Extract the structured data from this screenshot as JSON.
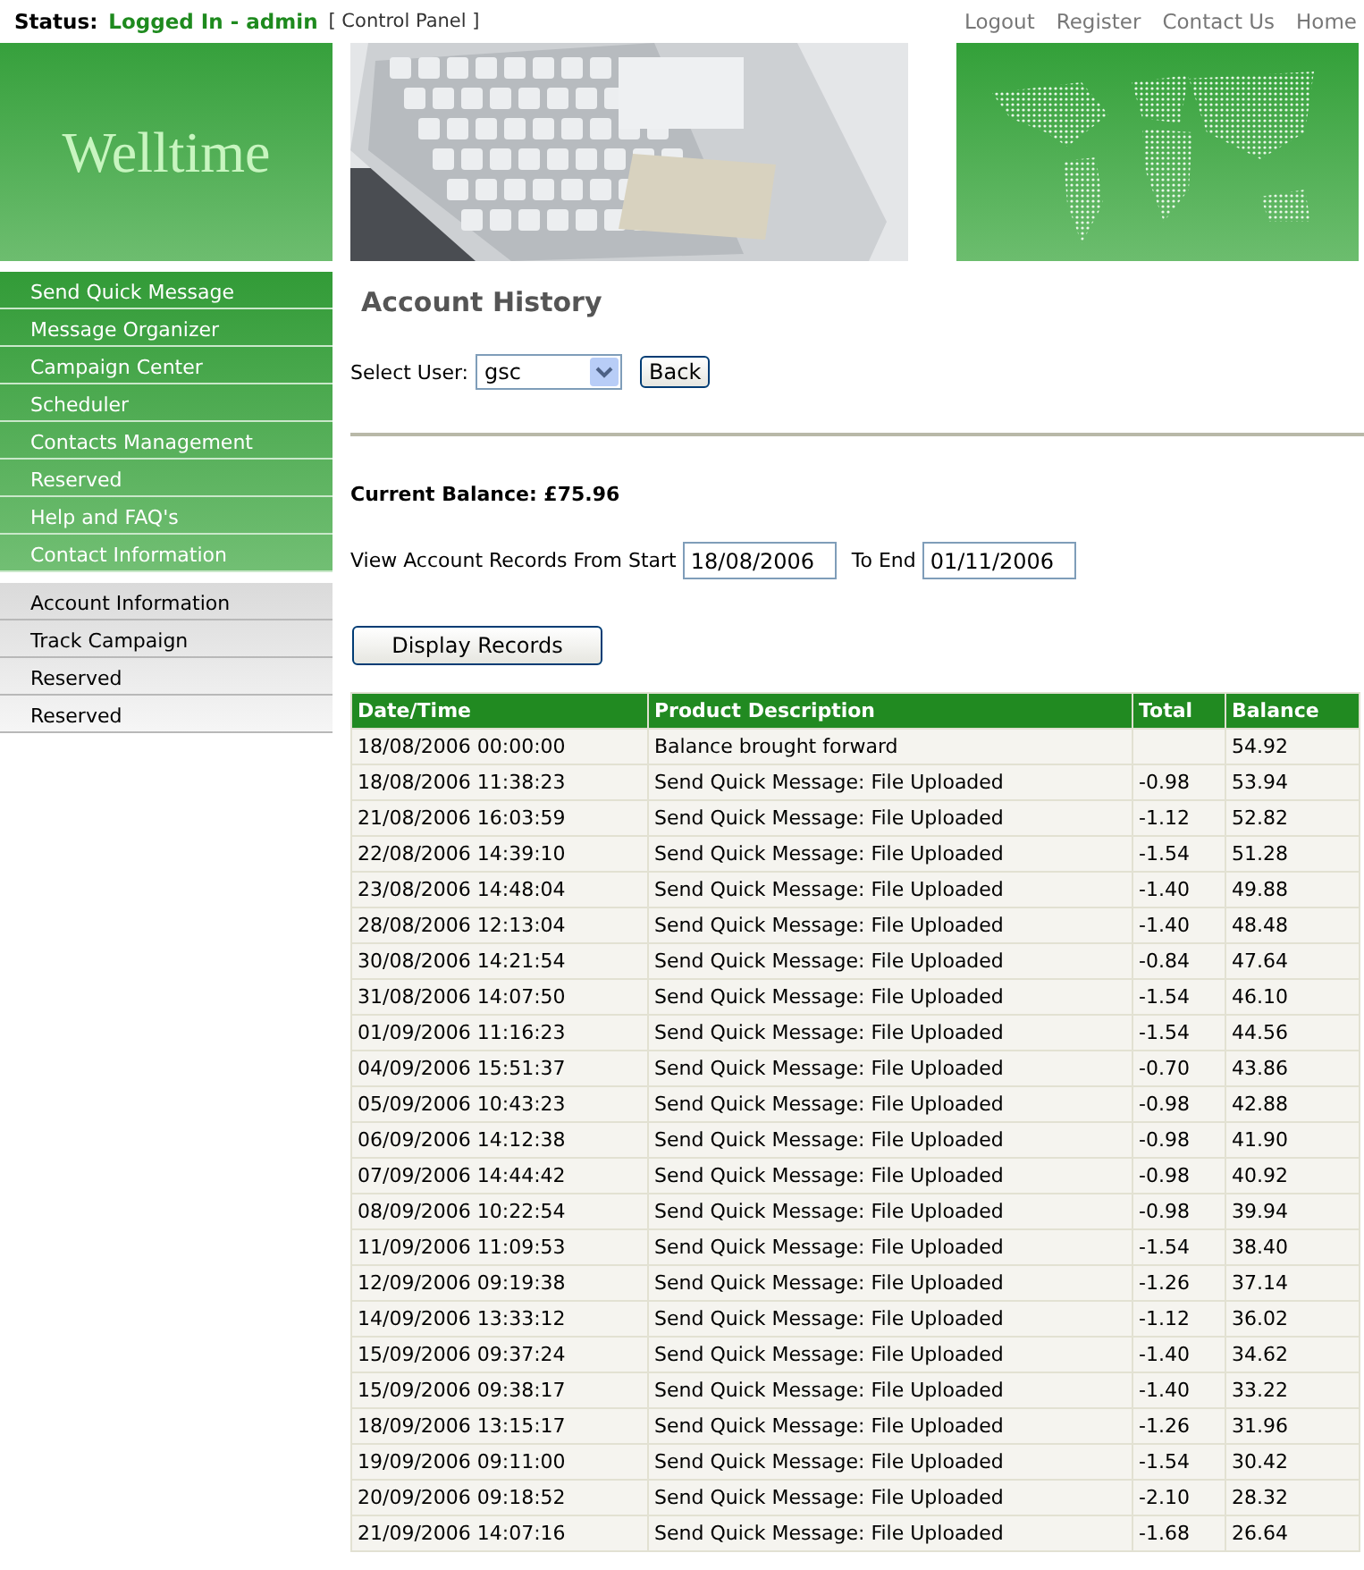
{
  "status": {
    "label": "Status:",
    "value": "Logged In - admin",
    "link": "[ Control Panel ]"
  },
  "top_links": [
    "Logout",
    "Register",
    "Contact Us",
    "Home"
  ],
  "logo": "Welltime",
  "main_menu": [
    "Send Quick Message",
    "Message Organizer",
    "Campaign Center",
    "Scheduler",
    "Contacts Management",
    "Reserved",
    "Help and FAQ's",
    "Contact Information"
  ],
  "account_menu": [
    "Account Information",
    "Track Campaign",
    "Reserved",
    "Reserved"
  ],
  "page_title": "Account History",
  "select_user": {
    "label": "Select User:",
    "value": "gsc"
  },
  "back_button": "Back",
  "current_balance": "Current Balance: £75.96",
  "records_range": {
    "label": "View Account Records From Start",
    "start": "18/08/2006",
    "to_label": "To End",
    "end": "01/11/2006"
  },
  "display_button": "Display Records",
  "table": {
    "columns": [
      "Date/Time",
      "Product Description",
      "Total",
      "Balance"
    ],
    "rows": [
      [
        "18/08/2006 00:00:00",
        "Balance brought forward",
        "",
        "54.92"
      ],
      [
        "18/08/2006 11:38:23",
        "Send Quick Message: File Uploaded",
        "-0.98",
        "53.94"
      ],
      [
        "21/08/2006 16:03:59",
        "Send Quick Message: File Uploaded",
        "-1.12",
        "52.82"
      ],
      [
        "22/08/2006 14:39:10",
        "Send Quick Message: File Uploaded",
        "-1.54",
        "51.28"
      ],
      [
        "23/08/2006 14:48:04",
        "Send Quick Message: File Uploaded",
        "-1.40",
        "49.88"
      ],
      [
        "28/08/2006 12:13:04",
        "Send Quick Message: File Uploaded",
        "-1.40",
        "48.48"
      ],
      [
        "30/08/2006 14:21:54",
        "Send Quick Message: File Uploaded",
        "-0.84",
        "47.64"
      ],
      [
        "31/08/2006 14:07:50",
        "Send Quick Message: File Uploaded",
        "-1.54",
        "46.10"
      ],
      [
        "01/09/2006 11:16:23",
        "Send Quick Message: File Uploaded",
        "-1.54",
        "44.56"
      ],
      [
        "04/09/2006 15:51:37",
        "Send Quick Message: File Uploaded",
        "-0.70",
        "43.86"
      ],
      [
        "05/09/2006 10:43:23",
        "Send Quick Message: File Uploaded",
        "-0.98",
        "42.88"
      ],
      [
        "06/09/2006 14:12:38",
        "Send Quick Message: File Uploaded",
        "-0.98",
        "41.90"
      ],
      [
        "07/09/2006 14:44:42",
        "Send Quick Message: File Uploaded",
        "-0.98",
        "40.92"
      ],
      [
        "08/09/2006 10:22:54",
        "Send Quick Message: File Uploaded",
        "-0.98",
        "39.94"
      ],
      [
        "11/09/2006 11:09:53",
        "Send Quick Message: File Uploaded",
        "-1.54",
        "38.40"
      ],
      [
        "12/09/2006 09:19:38",
        "Send Quick Message: File Uploaded",
        "-1.26",
        "37.14"
      ],
      [
        "14/09/2006 13:33:12",
        "Send Quick Message: File Uploaded",
        "-1.12",
        "36.02"
      ],
      [
        "15/09/2006 09:37:24",
        "Send Quick Message: File Uploaded",
        "-1.40",
        "34.62"
      ],
      [
        "15/09/2006 09:38:17",
        "Send Quick Message: File Uploaded",
        "-1.40",
        "33.22"
      ],
      [
        "18/09/2006 13:15:17",
        "Send Quick Message: File Uploaded",
        "-1.26",
        "31.96"
      ],
      [
        "19/09/2006 09:11:00",
        "Send Quick Message: File Uploaded",
        "-1.54",
        "30.42"
      ],
      [
        "20/09/2006 09:18:52",
        "Send Quick Message: File Uploaded",
        "-2.10",
        "28.32"
      ],
      [
        "21/09/2006 14:07:16",
        "Send Quick Message: File Uploaded",
        "-1.68",
        "26.64"
      ]
    ]
  }
}
